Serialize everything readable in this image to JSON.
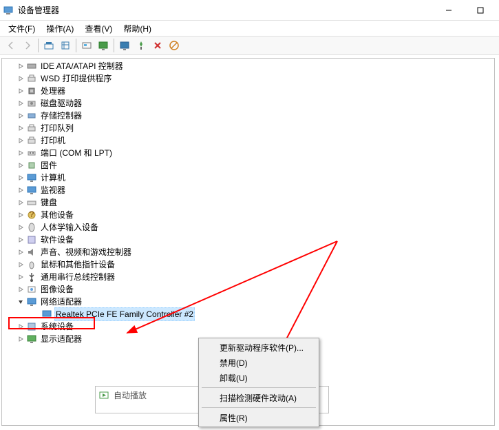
{
  "window": {
    "title": "设备管理器"
  },
  "menu": {
    "file": "文件(F)",
    "action": "操作(A)",
    "view": "查看(V)",
    "help": "帮助(H)"
  },
  "tree": {
    "items": [
      {
        "label": "IDE ATA/ATAPI 控制器",
        "icon": "ide"
      },
      {
        "label": "WSD 打印提供程序",
        "icon": "print"
      },
      {
        "label": "处理器",
        "icon": "cpu"
      },
      {
        "label": "磁盘驱动器",
        "icon": "disk"
      },
      {
        "label": "存储控制器",
        "icon": "storage"
      },
      {
        "label": "打印队列",
        "icon": "print"
      },
      {
        "label": "打印机",
        "icon": "print"
      },
      {
        "label": "端口 (COM 和 LPT)",
        "icon": "port"
      },
      {
        "label": "固件",
        "icon": "firmware"
      },
      {
        "label": "计算机",
        "icon": "monitor"
      },
      {
        "label": "监视器",
        "icon": "monitor"
      },
      {
        "label": "键盘",
        "icon": "keyboard"
      },
      {
        "label": "其他设备",
        "icon": "other"
      },
      {
        "label": "人体学输入设备",
        "icon": "hid"
      },
      {
        "label": "软件设备",
        "icon": "software"
      },
      {
        "label": "声音、视频和游戏控制器",
        "icon": "sound"
      },
      {
        "label": "鼠标和其他指针设备",
        "icon": "mouse"
      },
      {
        "label": "通用串行总线控制器",
        "icon": "usb"
      },
      {
        "label": "图像设备",
        "icon": "image"
      }
    ],
    "network_adapter": {
      "label": "网络适配器",
      "child": "Realtek PCIe FE Family Controller #2"
    },
    "after": [
      {
        "label": "系统设备",
        "icon": "system"
      },
      {
        "label": "显示适配器",
        "icon": "display"
      }
    ]
  },
  "context_menu": {
    "update_driver": "更新驱动程序软件(P)...",
    "disable": "禁用(D)",
    "uninstall": "卸载(U)",
    "scan": "扫描检测硬件改动(A)",
    "properties": "属性(R)"
  },
  "extra": {
    "autoplay": "自动播放"
  }
}
